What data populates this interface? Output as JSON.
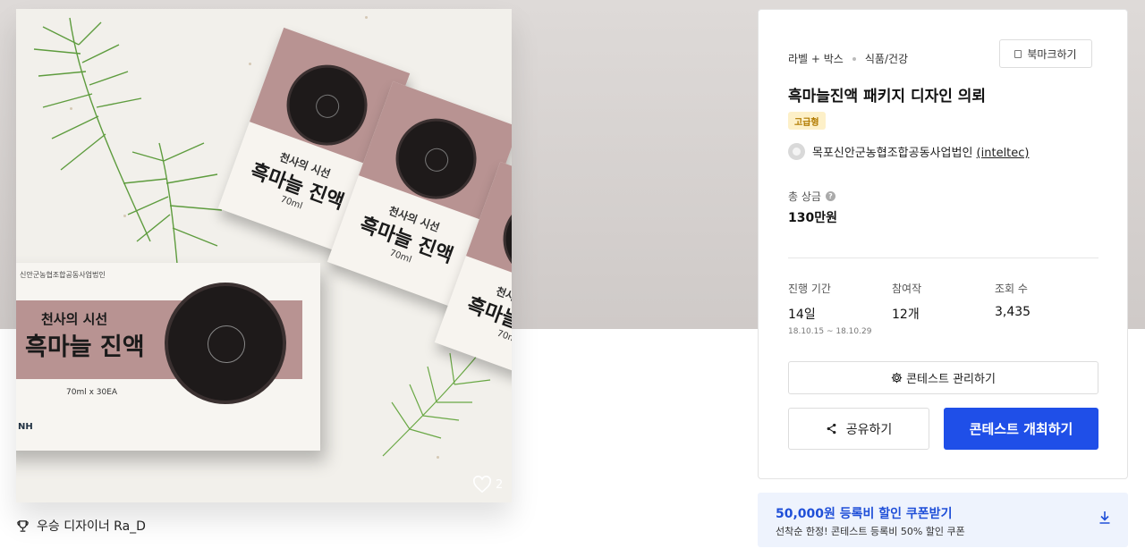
{
  "artwork": {
    "pack_line1": "천사의 시선",
    "pack_line2": "흑마늘 진액",
    "pack_volume": "70ml",
    "box_topline": "신안군농협조합공동사업법인",
    "box_line1": "천사의 시선",
    "box_line2": "흑마늘 진액",
    "box_volume": "70ml x 30EA",
    "logos": "NH"
  },
  "like_count": "2",
  "winner": {
    "icon": "trophy-icon",
    "label": "우승 디자이너 Ra_D"
  },
  "card": {
    "category": "라벨 + 박스",
    "subcategory": "식품/건강",
    "bookmark_label": "북마크하기",
    "title": "흑마늘진액 패키지 디자인 의뢰",
    "tier": "고급형",
    "host_name": "목포신안군농협조합공동사업법인 ",
    "host_id": "(inteltec)",
    "prize_label": "총 상금",
    "prize_value": "130만원",
    "stats": {
      "period_label": "진행 기간",
      "period_value": "14일",
      "period_range": "18.10.15 ~ 18.10.29",
      "entries_label": "참여작",
      "entries_value": "12개",
      "views_label": "조회 수",
      "views_value": "3,435"
    },
    "manage_label": "콘테스트 관리하기",
    "share_label": "공유하기",
    "host_button_label": "콘테스트 개최하기"
  },
  "coupon": {
    "title": "50,000원 등록비 할인 쿠폰받기",
    "desc": "선착순 한정! 콘테스트 등록비 50% 할인 쿠폰"
  },
  "colors": {
    "primary": "#1f4fe8",
    "tier_bg": "#fdf0c8",
    "tier_text": "#b27b00",
    "coupon_bg": "#eef3fd"
  }
}
